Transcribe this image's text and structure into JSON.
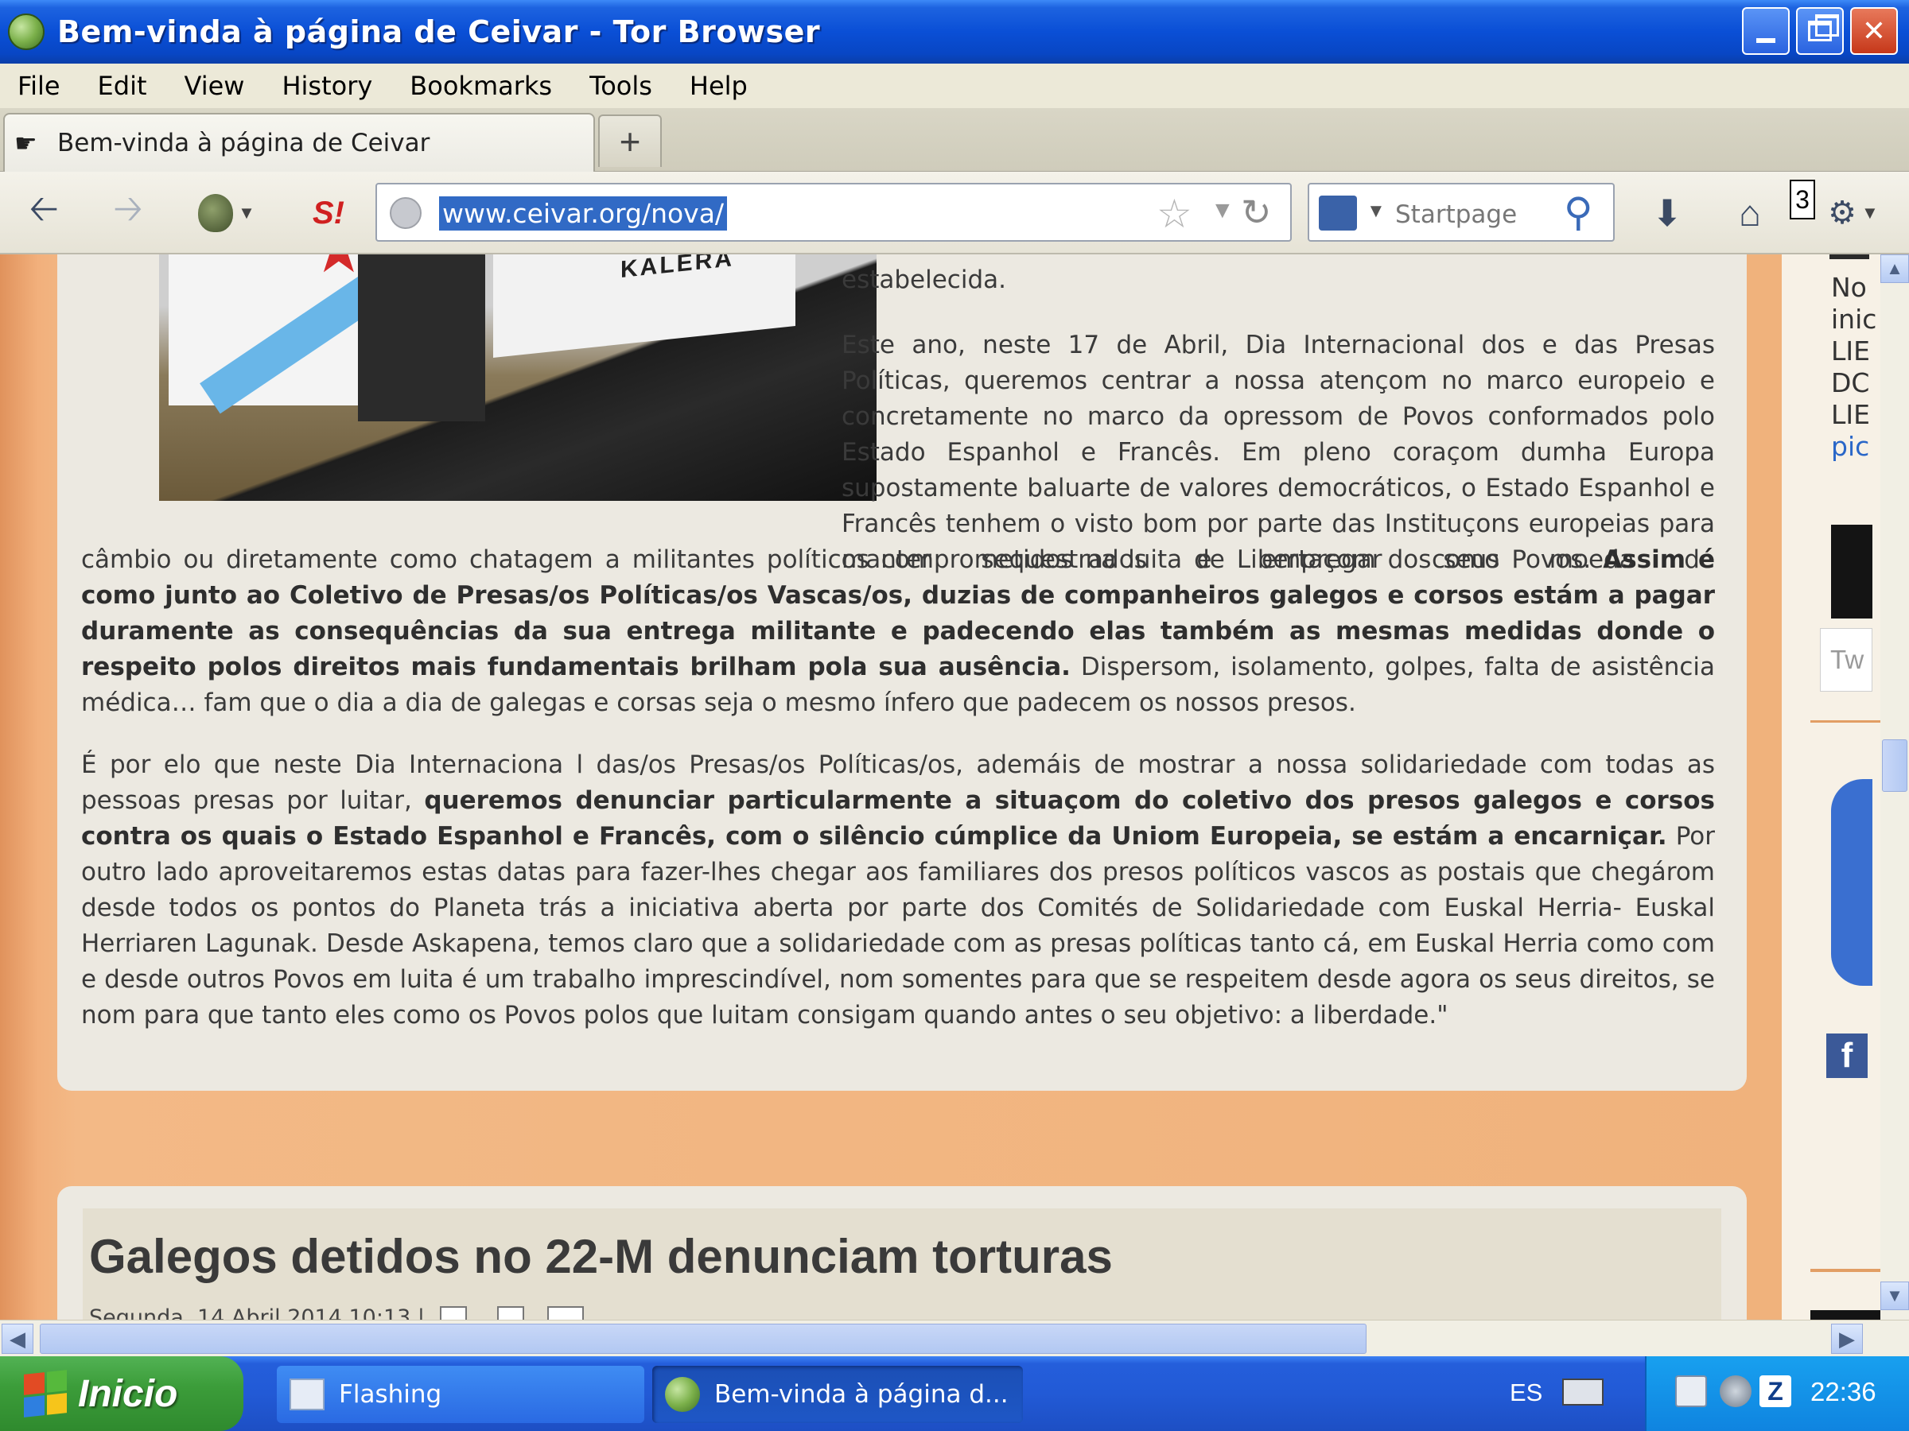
{
  "window": {
    "title": "Bem-vinda à página de Ceivar - Tor Browser"
  },
  "menu": [
    "File",
    "Edit",
    "View",
    "History",
    "Bookmarks",
    "Tools",
    "Help"
  ],
  "tab": {
    "label": "Bem-vinda à página de Ceivar",
    "new_tab_symbol": "+"
  },
  "toolbar": {
    "url": "www.ceivar.org/nova/",
    "search_placeholder": "Startpage",
    "badge_count": "3",
    "icons": [
      "back-arrow-icon",
      "forward-arrow-icon",
      "onion-icon",
      "noscript-icon",
      "site-identity-icon",
      "bookmark-star-icon",
      "reload-icon",
      "search-engine-icon",
      "search-icon",
      "downloads-icon",
      "home-icon",
      "tor-button-icon"
    ]
  },
  "article": {
    "photo_banner_text": "KALERA",
    "lead_line": "estabelecida.",
    "paragraph1_wrapped": "Este ano, neste 17 de Abril, Dia Internacional dos e das Presas Políticas, queremos centrar a nossa atençom no marco europeio e concretamente no marco da opressom de Povos conformados polo Estado Espanhol e Francês. Em pleno coraçom dumha Europa supostamente baluarte de valores democráticos, o Estado Espanhol e Francês tenhem o visto bom por parte das Instituçons europeias para manter sequestrados e empregar como moeda de",
    "paragraph1_full_a": "câmbio ou diretamente como chatagem a militantes políticos comprometidos na luita de Libertaçom dos seus Povos. ",
    "paragraph1_bold": "Assim é como junto ao Coletivo de Presas/os Políticas/os Vascas/os, duzias de companheiros galegos e corsos estám a pagar duramente as consequências da sua entrega militante e padecendo elas também as mesmas medidas donde o respeito polos direitos mais fundamentais brilham pola sua ausência.",
    "paragraph1_full_b": " Dispersom, isolamento, golpes, falta de asistência médica… fam que o dia a dia de galegas e corsas seja o mesmo ínfero que padecem os nossos presos.",
    "paragraph2_a": "É por elo que neste Dia Internaciona l das/os Presas/os Políticas/os, ademáis de mostrar a nossa solidariedade com todas as pessoas presas por luitar, ",
    "paragraph2_bold": "queremos denunciar particularmente a situaçom do coletivo dos presos galegos e corsos contra os quais o Estado Espanhol e Francês, com o silêncio cúmplice da Uniom Europeia, se estám a encarniçar.",
    "paragraph2_b": " Por outro lado aproveitaremos estas datas para fazer-lhes chegar aos familiares dos presos políticos vascos as postais que chegárom desde todos os pontos do Planeta trás a iniciativa aberta por parte dos Comités de Solidariedade com Euskal Herria- Euskal Herriaren Lagunak. Desde Askapena, temos claro que a solidariedade com as presas políticas tanto cá, em Euskal Herria como com e desde outros Povos em luita é um trabalho imprescindível, nom somentes para que se respeitem desde agora os seus direitos, se nom para que tanto eles como os Povos polos que luitam consigam quando antes o seu objetivo: a liberdade.\""
  },
  "article2": {
    "title": "Galegos detidos no 22-M denunciam torturas",
    "meta": "Segunda, 14 Abril 2014 10:13 |"
  },
  "sidebar_fragments": [
    "No",
    "inic",
    "LIE",
    "DC",
    "LIE",
    "pic",
    "Tw"
  ],
  "taskbar": {
    "start_label": "Inicio",
    "items": [
      "Flashing",
      "Bem-vinda à página d..."
    ],
    "language": "ES",
    "clock": "22:36"
  }
}
